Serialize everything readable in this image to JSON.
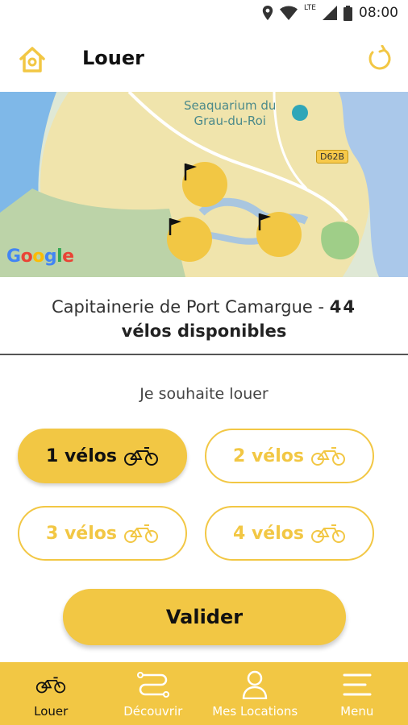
{
  "status_bar": {
    "network": "LTE",
    "time": "08:00"
  },
  "header": {
    "title": "Louer"
  },
  "map": {
    "labels": {
      "seaquarium_line1": "Seaquarium du",
      "seaquarium_line2": "Grau-du-Roi",
      "road": "D62B"
    },
    "attribution": "Google"
  },
  "station": {
    "name": "Capitainerie de Port Camargue - ",
    "count": "44",
    "suffix": "vélos disponibles"
  },
  "rental": {
    "prompt": "Je souhaite louer",
    "options": [
      {
        "label": "1 vélos",
        "selected": true
      },
      {
        "label": "2 vélos",
        "selected": false
      },
      {
        "label": "3 vélos",
        "selected": false
      },
      {
        "label": "4 vélos",
        "selected": false
      }
    ],
    "validate_label": "Valider"
  },
  "nav": {
    "items": [
      {
        "label": "Louer",
        "icon": "bike-icon",
        "active": true
      },
      {
        "label": "Découvrir",
        "icon": "route-icon",
        "active": false
      },
      {
        "label": "Mes Locations",
        "icon": "user-icon",
        "active": false
      },
      {
        "label": "Menu",
        "icon": "menu-icon",
        "active": false
      }
    ]
  },
  "colors": {
    "accent": "#f2c744",
    "map_land": "#f3e3a4",
    "map_water": "#7fb8e8"
  }
}
